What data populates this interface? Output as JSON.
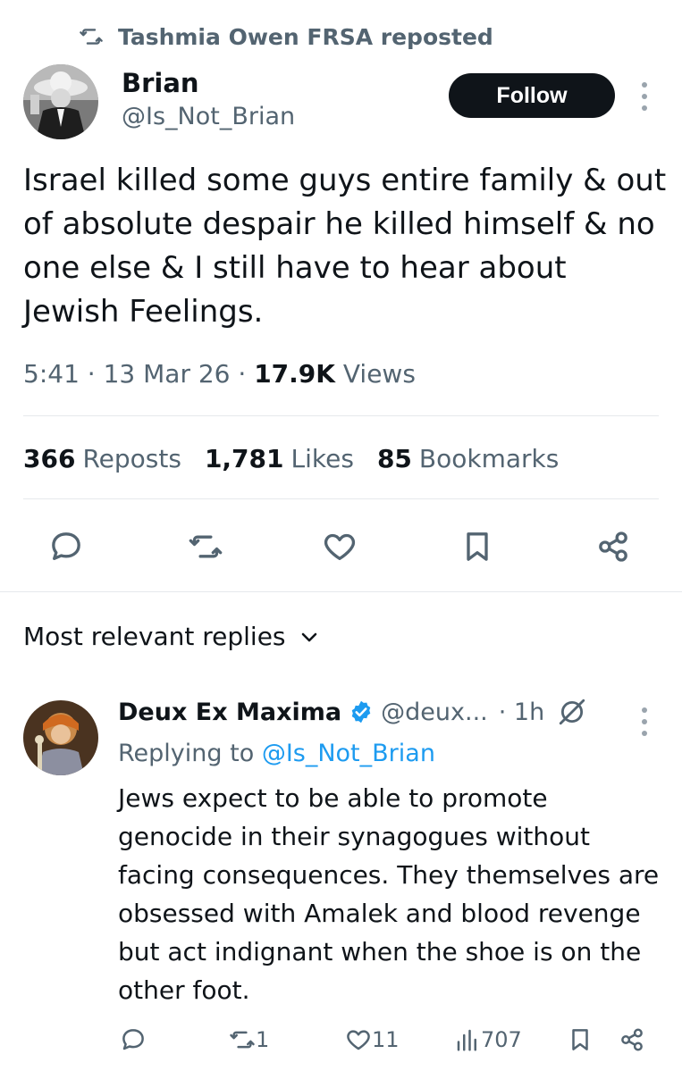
{
  "repost_banner": {
    "text": "Tashmia Owen FRSA reposted"
  },
  "tweet": {
    "author_name": "Brian",
    "author_handle": "@Is_Not_Brian",
    "follow_label": "Follow",
    "text": "Israel killed some guys entire family & out of absolute despair he killed himself & no one else & I still have to hear about Jewish Feelings.",
    "time": "5:41",
    "date": "13 Mar 26",
    "views_count": "17.9K",
    "views_label": "Views",
    "reposts_count": "366",
    "reposts_label": "Reposts",
    "likes_count": "1,781",
    "likes_label": "Likes",
    "bookmarks_count": "85",
    "bookmarks_label": "Bookmarks"
  },
  "replies_header": {
    "label": "Most relevant replies"
  },
  "reply": {
    "author_name": "Deux Ex Maxima",
    "author_handle": "@deux...",
    "time": "1h",
    "replying_prefix": "Replying to",
    "replying_handle": "@Is_Not_Brian",
    "text": "Jews expect to be able to promote genocide in their synagogues without facing consequences. They themselves are obsessed with Amalek and blood revenge but act indignant when the shoe is on the other foot.",
    "reposts": "1",
    "likes": "11",
    "views": "707"
  },
  "colors": {
    "text": "#0f1419",
    "muted": "#536471",
    "link": "#1d9bf0",
    "verified": "#1d9bf0",
    "divider": "#e6e9ec"
  },
  "icons": [
    "repost-icon",
    "more-icon",
    "reply-icon",
    "like-icon",
    "bookmark-icon",
    "share-icon",
    "chevron-down-icon",
    "verified-icon",
    "grok-icon",
    "views-icon"
  ]
}
